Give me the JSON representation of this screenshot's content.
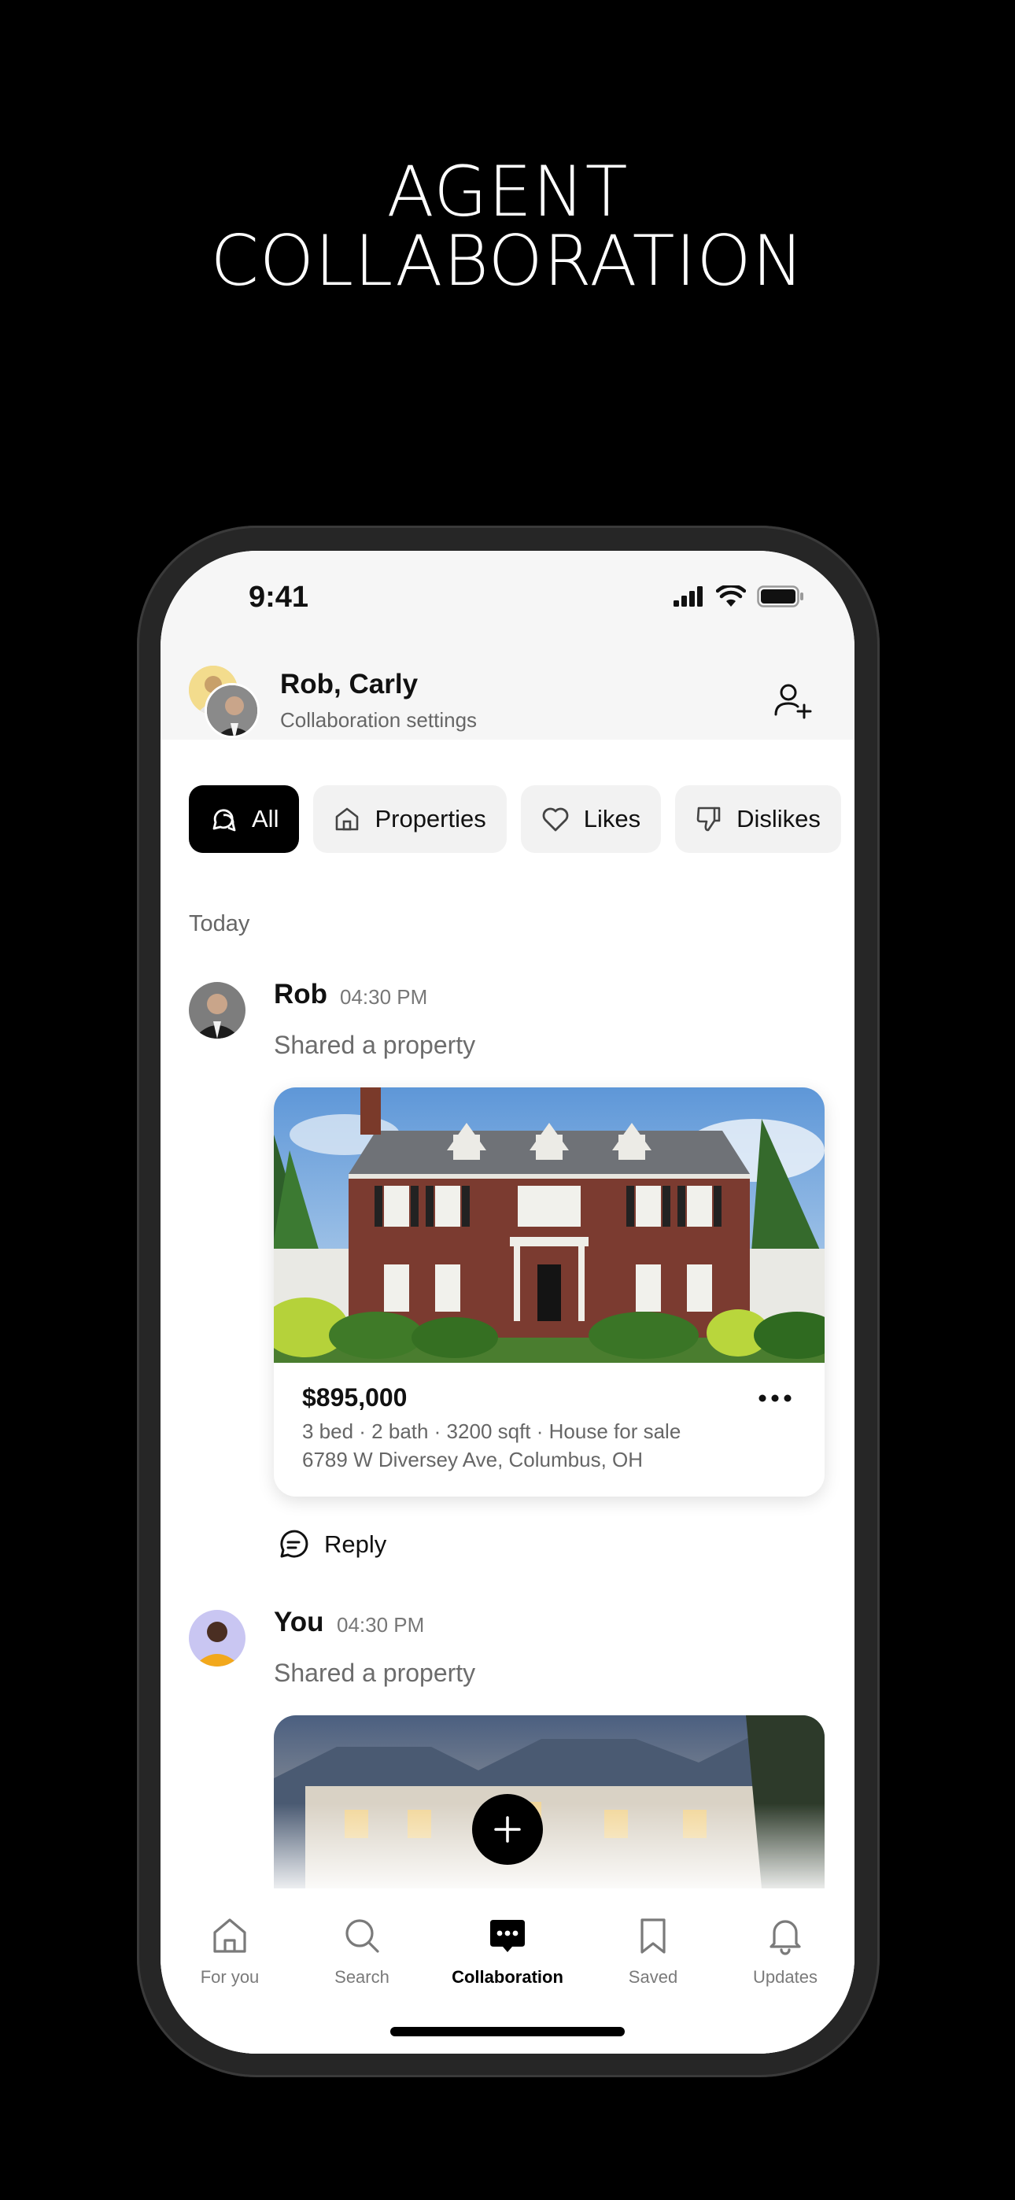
{
  "headline": {
    "line1": "AGENT",
    "line2": "COLLABORATION"
  },
  "status_bar": {
    "time": "9:41"
  },
  "header": {
    "title": "Rob, Carly",
    "subtitle": "Collaboration settings"
  },
  "filters": [
    {
      "label": "All",
      "icon": "chat-bubbles-icon",
      "active": true
    },
    {
      "label": "Properties",
      "icon": "home-icon",
      "active": false
    },
    {
      "label": "Likes",
      "icon": "heart-icon",
      "active": false
    },
    {
      "label": "Dislikes",
      "icon": "thumbs-down-icon",
      "active": false
    }
  ],
  "feed": {
    "section_label": "Today",
    "messages": [
      {
        "sender": "Rob",
        "time": "04:30 PM",
        "text": "Shared a property",
        "property": {
          "price": "$895,000",
          "details": "3 bed · 2 bath · 3200 sqft · House for sale",
          "address": "6789 W Diversey Ave, Columbus, OH"
        },
        "reply_label": "Reply"
      },
      {
        "sender": "You",
        "time": "04:30 PM",
        "text": "Shared a property"
      }
    ]
  },
  "tabbar": {
    "items": [
      {
        "label": "For you",
        "icon": "home-icon",
        "active": false
      },
      {
        "label": "Search",
        "icon": "search-icon",
        "active": false
      },
      {
        "label": "Collaboration",
        "icon": "chat-icon",
        "active": true
      },
      {
        "label": "Saved",
        "icon": "bookmark-icon",
        "active": false
      },
      {
        "label": "Updates",
        "icon": "bell-icon",
        "active": false
      }
    ]
  },
  "colors": {
    "background": "#000000",
    "accent": "#000000",
    "chip_bg": "#f2f2f2",
    "muted_text": "#666666"
  }
}
